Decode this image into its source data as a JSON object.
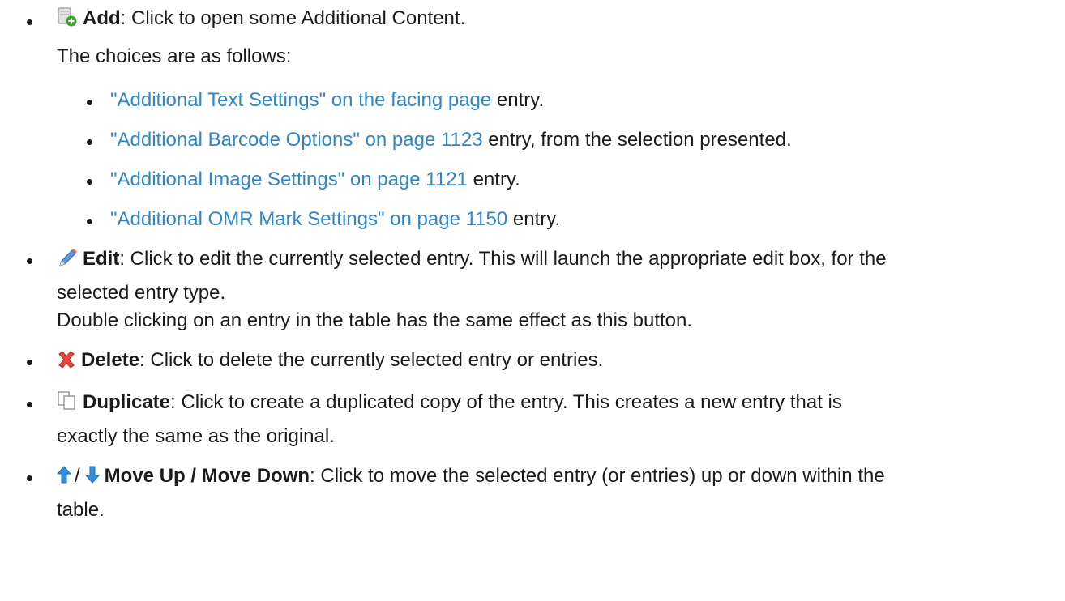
{
  "items": {
    "add": {
      "icon": "add-content-icon",
      "label": "Add",
      "text": ": Click to open some Additional Content.",
      "choices_intro": "The choices are as follows:",
      "choices": [
        {
          "link": "\"Additional Text Settings\" on the facing page",
          "text": " entry."
        },
        {
          "link": "\"Additional Barcode Options\" on page 1123",
          "text": " entry, from the selection presented."
        },
        {
          "link": "\"Additional Image Settings\" on page 1121",
          "text": " entry."
        },
        {
          "link": "\"Additional OMR Mark Settings\" on page 1150",
          "text": " entry."
        }
      ]
    },
    "edit": {
      "icon": "pencil-icon",
      "label": "Edit",
      "text": ": Click to edit the currently selected entry. This will launch the appropriate edit box, for the",
      "text2": "selected entry type.",
      "note": "Double clicking on an entry in the table has the same effect as this button."
    },
    "delete": {
      "icon": "red-x-icon",
      "label": "Delete",
      "text": ": Click to delete the currently selected entry or entries."
    },
    "duplicate": {
      "icon": "copy-pages-icon",
      "label": "Duplicate",
      "text": ": Click to create a duplicated copy of the entry. This creates a new entry that is",
      "text2": "exactly the same as the original."
    },
    "move": {
      "icon_up": "arrow-up-icon",
      "separator": "/",
      "icon_down": "arrow-down-icon",
      "label": "Move Up / Move Down",
      "text": ": Click to move the selected entry (or entries) up or down within the",
      "text2": "table."
    }
  },
  "colors": {
    "link": "#2f86c8",
    "text": "#1a1a1a",
    "delete_icon": "#e8463a",
    "arrow_icon": "#2f8fdc",
    "add_badge": "#43a32d"
  }
}
